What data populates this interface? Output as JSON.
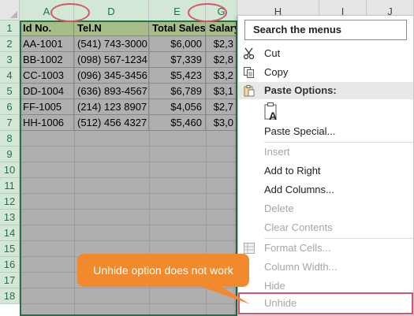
{
  "column_headers": [
    {
      "label": "A",
      "selected": true
    },
    {
      "label": "D",
      "selected": true
    },
    {
      "label": "E",
      "selected": true
    },
    {
      "label": "G",
      "selected": true
    },
    {
      "label": "H",
      "selected": false
    },
    {
      "label": "I",
      "selected": false
    },
    {
      "label": "J",
      "selected": false
    }
  ],
  "row_numbers": [
    "1",
    "2",
    "3",
    "4",
    "5",
    "6",
    "7",
    "8",
    "9",
    "10",
    "11",
    "12",
    "13",
    "14",
    "15",
    "16",
    "17",
    "18"
  ],
  "table": {
    "headers": [
      "Id No.",
      "Tel.N",
      "Total Sales",
      "Salary"
    ],
    "rows": [
      [
        "AA-1001",
        "(541) 743-3000",
        "$6,000",
        "$2,3"
      ],
      [
        "BB-1002",
        "(098) 567-1234",
        "$7,339",
        "$2,8"
      ],
      [
        "CC-1003",
        "(096) 345-3456",
        "$5,423",
        "$3,2"
      ],
      [
        "DD-1004",
        "(636) 893-4567",
        "$6,789",
        "$3,1"
      ],
      [
        "FF-1005",
        "(214) 123 8907",
        "$4,056",
        "$2,7"
      ],
      [
        "HH-1006",
        "(512) 456 4327",
        "$5,460",
        "$3,0"
      ]
    ]
  },
  "context_menu": {
    "search_label": "Search the menus",
    "cut": "Cut",
    "copy": "Copy",
    "paste_options": "Paste Options:",
    "paste_special": "Paste Special...",
    "insert": "Insert",
    "add_to_right": "Add to Right",
    "add_columns": "Add Columns...",
    "delete": "Delete",
    "clear_contents": "Clear Contents",
    "format_cells": "Format Cells...",
    "column_width": "Column Width...",
    "hide": "Hide",
    "unhide": "Unhide"
  },
  "callout": {
    "text": "Unhide option does not work"
  },
  "colors": {
    "selection_green": "#217346",
    "header_fill": "#a6bc89",
    "highlight_red": "#d9536b",
    "callout_orange": "#f08a2c"
  }
}
